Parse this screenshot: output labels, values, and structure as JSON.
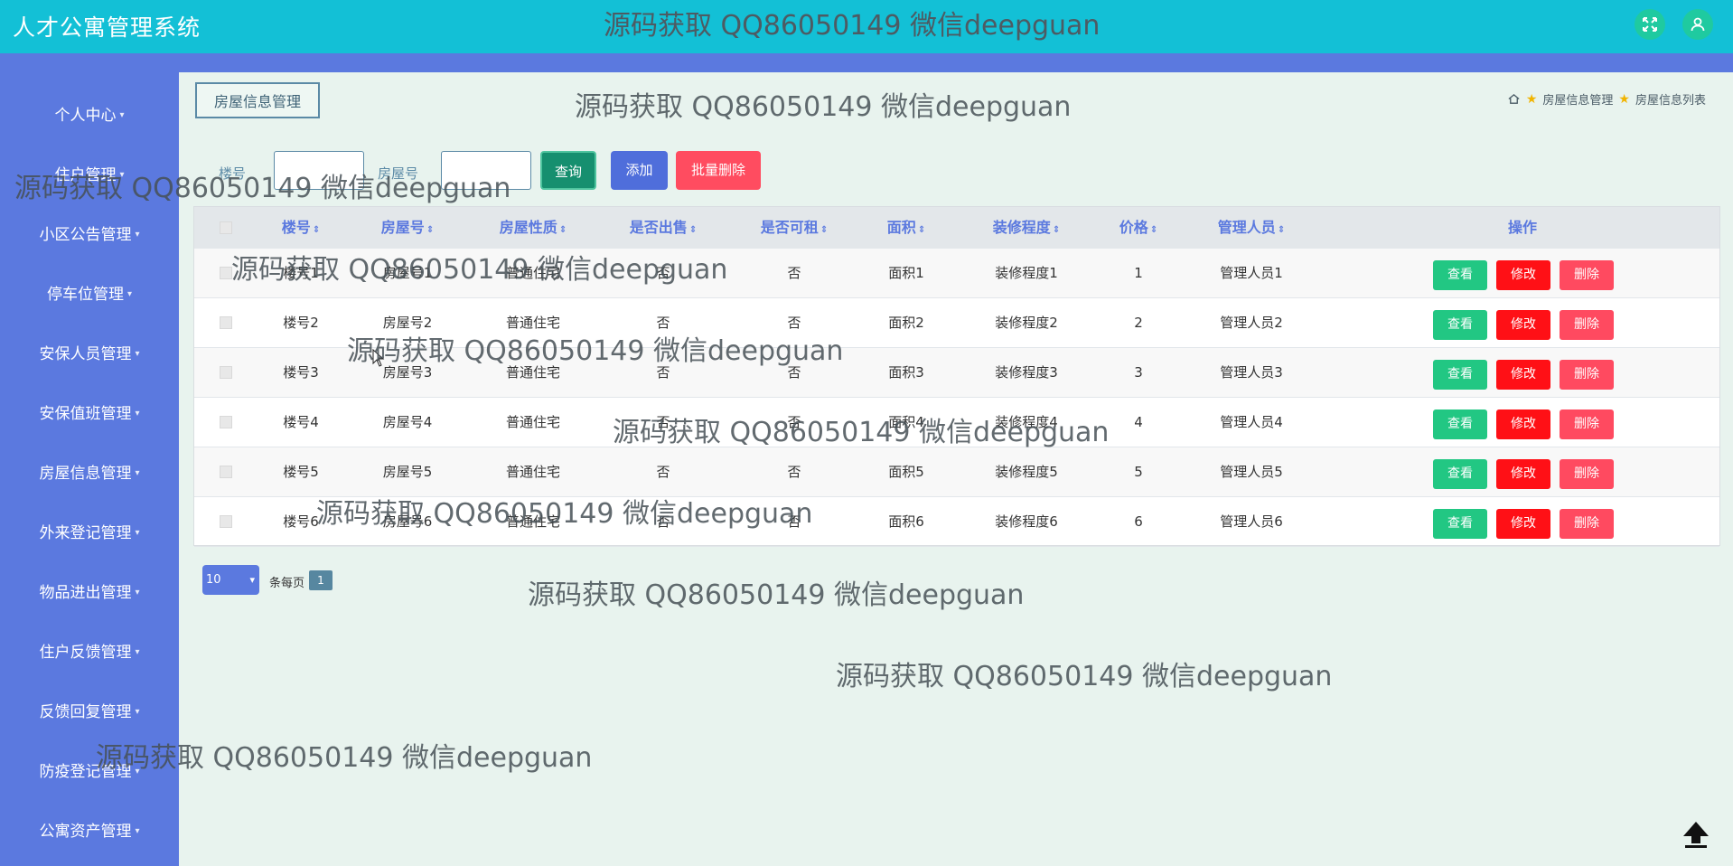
{
  "app": {
    "title": "人才公寓管理系统"
  },
  "header": {
    "fullscreen_icon": "fullscreen-icon",
    "user_icon": "user-icon"
  },
  "sidebar": {
    "items": [
      {
        "label": "个人中心"
      },
      {
        "label": "住户管理"
      },
      {
        "label": "小区公告管理"
      },
      {
        "label": "停车位管理"
      },
      {
        "label": "安保人员管理"
      },
      {
        "label": "安保值班管理"
      },
      {
        "label": "房屋信息管理"
      },
      {
        "label": "外来登记管理"
      },
      {
        "label": "物品进出管理"
      },
      {
        "label": "住户反馈管理"
      },
      {
        "label": "反馈回复管理"
      },
      {
        "label": "防疫登记管理"
      },
      {
        "label": "公寓资产管理"
      }
    ]
  },
  "page": {
    "section_button": "房屋信息管理"
  },
  "breadcrumb": {
    "level1": "房屋信息管理",
    "level2": "房屋信息列表"
  },
  "search": {
    "building_label": "楼号",
    "room_label": "房屋号",
    "building_value": "",
    "room_value": "",
    "query_button": "查询",
    "add_button": "添加",
    "batch_delete_button": "批量删除"
  },
  "table": {
    "headers": [
      "楼号",
      "房屋号",
      "房屋性质",
      "是否出售",
      "是否可租",
      "面积",
      "装修程度",
      "价格",
      "管理人员",
      "操作"
    ],
    "rows": [
      [
        "楼号1",
        "房屋号1",
        "普通住宅",
        "否",
        "否",
        "面积1",
        "装修程度1",
        "1",
        "管理人员1"
      ],
      [
        "楼号2",
        "房屋号2",
        "普通住宅",
        "否",
        "否",
        "面积2",
        "装修程度2",
        "2",
        "管理人员2"
      ],
      [
        "楼号3",
        "房屋号3",
        "普通住宅",
        "否",
        "否",
        "面积3",
        "装修程度3",
        "3",
        "管理人员3"
      ],
      [
        "楼号4",
        "房屋号4",
        "普通住宅",
        "否",
        "否",
        "面积4",
        "装修程度4",
        "4",
        "管理人员4"
      ],
      [
        "楼号5",
        "房屋号5",
        "普通住宅",
        "否",
        "否",
        "面积5",
        "装修程度5",
        "5",
        "管理人员5"
      ],
      [
        "楼号6",
        "房屋号6",
        "普通住宅",
        "否",
        "否",
        "面积6",
        "装修程度6",
        "6",
        "管理人员6"
      ]
    ],
    "actions": {
      "view": "查看",
      "edit": "修改",
      "delete": "删除"
    }
  },
  "pagination": {
    "page_size": "10",
    "per_page_label": "条每页",
    "current_page": "1"
  },
  "watermark": {
    "text": "源码获取 QQ86050149 微信deepguan"
  },
  "colors": {
    "header_bg": "#13c0d6",
    "sidebar_bg": "#5b79df",
    "content_bg": "#e8f3ee",
    "view_btn": "#22c783",
    "edit_btn": "#ff1016",
    "delete_btn": "#ff4a60"
  }
}
